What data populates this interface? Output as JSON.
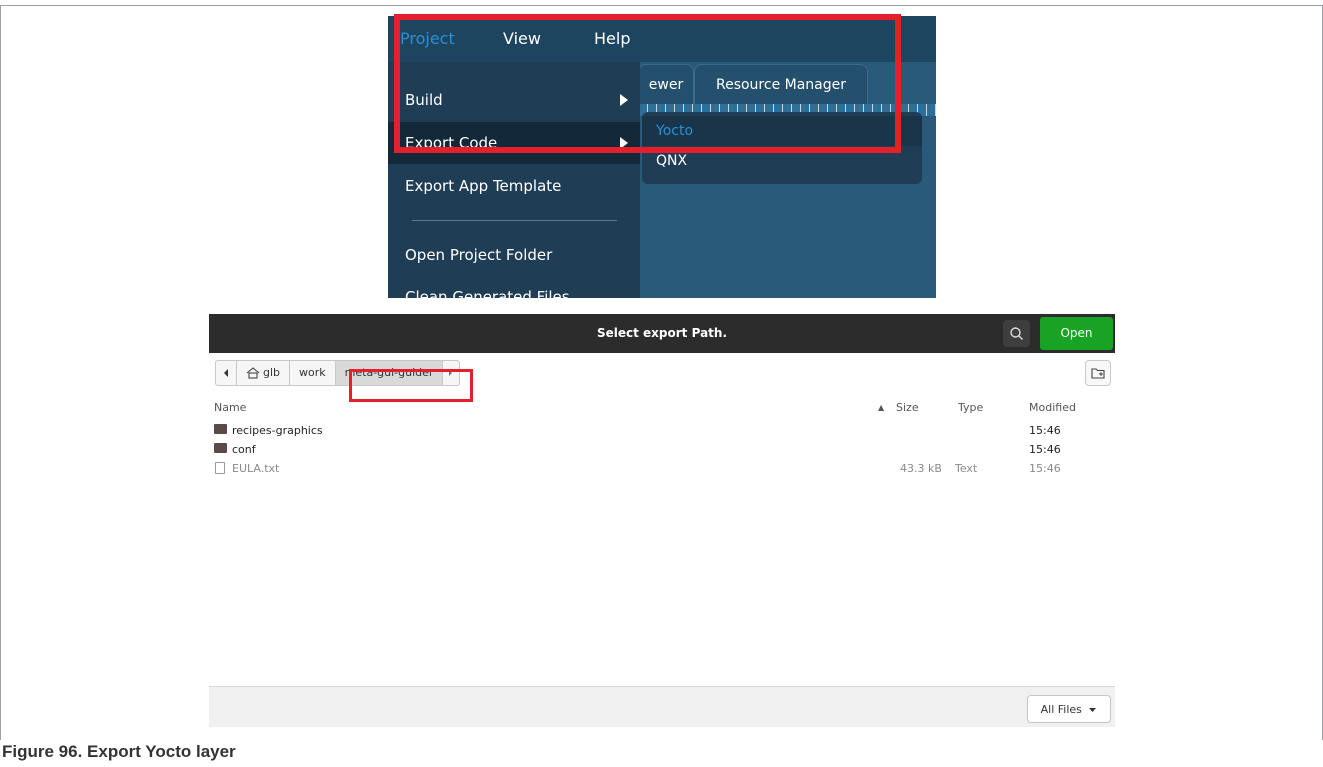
{
  "menu_screenshot": {
    "menubar": [
      "Project",
      "View",
      "Help"
    ],
    "tabs": [
      "ewer",
      "Resource Manager"
    ],
    "project_menu": [
      {
        "label": "Build",
        "has_submenu": true
      },
      {
        "label": "Export Code",
        "has_submenu": true,
        "highlighted": true
      },
      {
        "label": "Export App Template",
        "has_submenu": false
      },
      {
        "label": "Open Project Folder",
        "has_submenu": false
      },
      {
        "label": "Clean Generated Files",
        "has_submenu": false
      }
    ],
    "export_submenu": [
      {
        "label": "Yocto",
        "highlighted": true
      },
      {
        "label": "QNX",
        "highlighted": false
      }
    ],
    "colors": {
      "highlight_text": "#2b8fd6",
      "menu_bg": "#1f3e56",
      "annotation": "#e3202b"
    }
  },
  "dialog": {
    "title": "Select export Path.",
    "open_button": "Open",
    "breadcrumbs": [
      "glb",
      "work",
      "meta-gui-guider"
    ],
    "columns": {
      "name": "Name",
      "size": "Size",
      "type": "Type",
      "modified": "Modified"
    },
    "sort_indicator": "▲",
    "files": [
      {
        "name": "recipes-graphics",
        "kind": "folder",
        "size": "",
        "type": "",
        "modified": "15:46"
      },
      {
        "name": "conf",
        "kind": "folder",
        "size": "",
        "type": "",
        "modified": "15:46"
      },
      {
        "name": "EULA.txt",
        "kind": "file",
        "size": "43.3 kB",
        "type": "Text",
        "modified": "15:46"
      }
    ],
    "filter": "All Files"
  },
  "caption": "Figure 96.  Export Yocto layer"
}
